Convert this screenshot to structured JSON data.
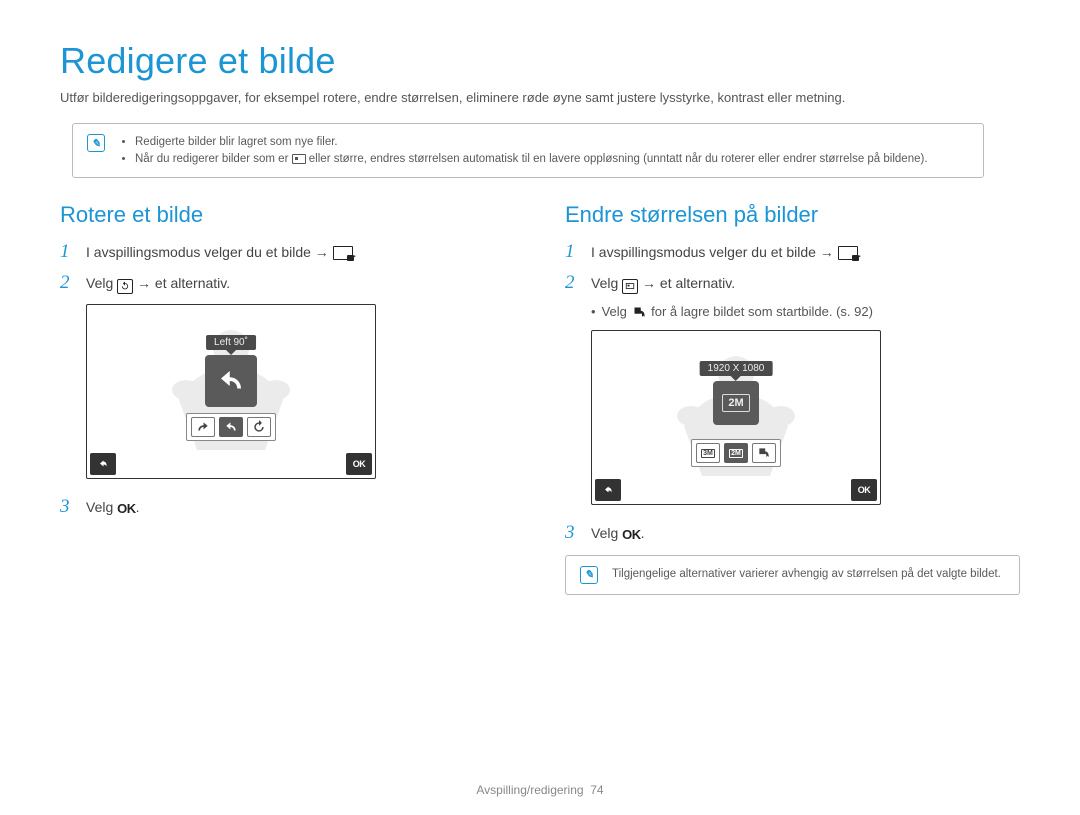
{
  "page": {
    "title": "Redigere et bilde",
    "description": "Utfør bilderedigeringsoppgaver, for eksempel rotere, endre størrelsen, eliminere røde øyne samt justere lysstyrke, kontrast eller metning."
  },
  "top_note": {
    "items": [
      "Redigerte bilder blir lagret som nye filer.",
      "Når du redigerer bilder som er   eller større, endres størrelsen automatisk til en lavere oppløsning (unntatt når du roterer eller endrer størrelse på bildene)."
    ]
  },
  "left": {
    "heading": "Rotere et bilde",
    "step1": "I avspillingsmodus velger du et bilde →",
    "step2_a": "Velg",
    "step2_b": "→ et alternativ.",
    "step3": "Velg",
    "screen": {
      "tooltip": "Left 90˚",
      "ok": "OK"
    }
  },
  "right": {
    "heading": "Endre størrelsen på bilder",
    "step1": "I avspillingsmodus velger du et bilde →",
    "step2_a": "Velg",
    "step2_b": "→ et alternativ.",
    "sub": "for å lagre bildet som startbilde. (s. 92)",
    "sub_pre": "Velg",
    "step3": "Velg",
    "screen": {
      "tooltip": "1920 X 1080",
      "big_label": "2M",
      "ok": "OK",
      "opts": [
        "3M",
        "2M"
      ]
    },
    "bottom_note": "Tilgjengelige alternativer varierer avhengig av størrelsen på det valgte bildet."
  },
  "footer": {
    "section": "Avspilling/redigering",
    "page_num": "74"
  }
}
